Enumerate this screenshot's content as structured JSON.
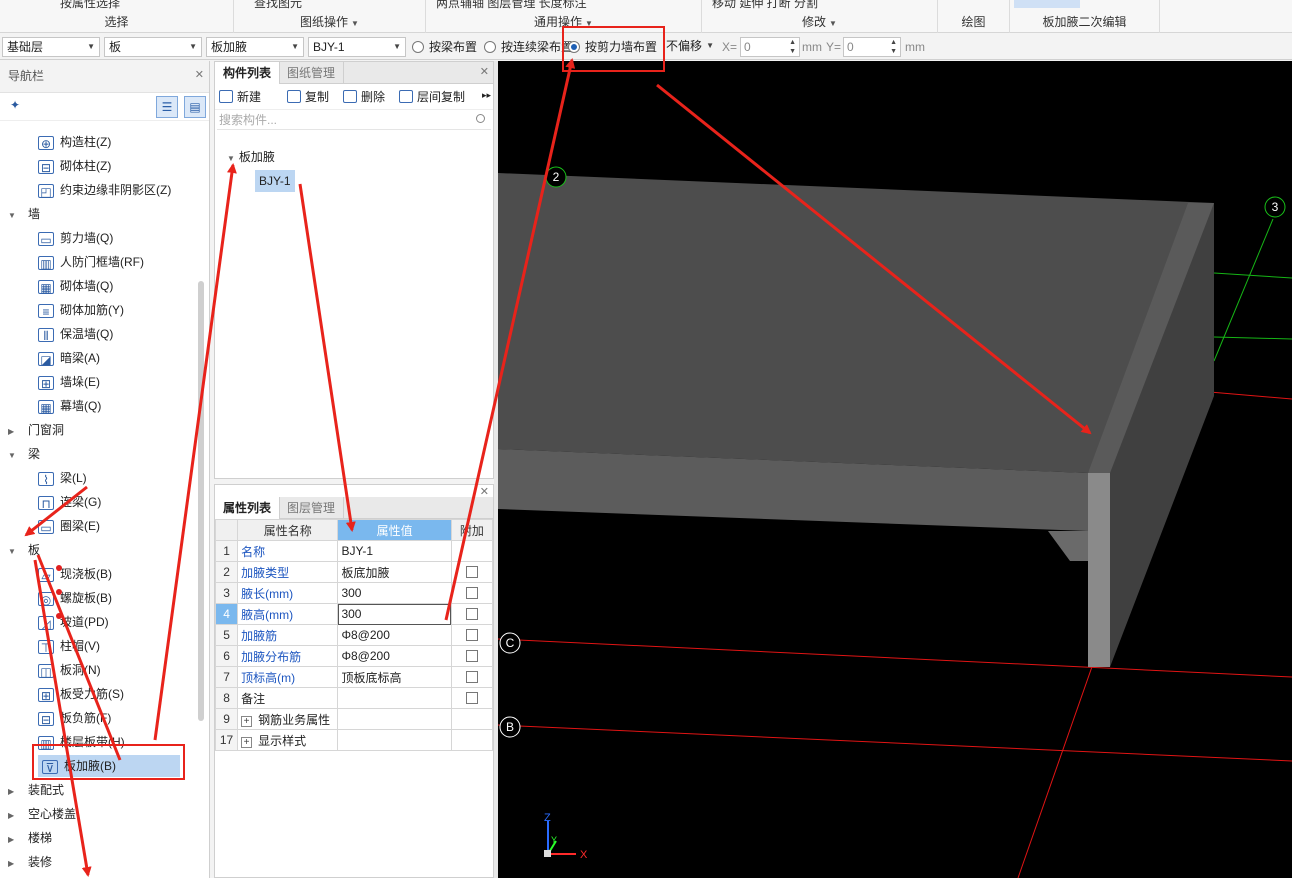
{
  "ribbon": {
    "groups": [
      {
        "label": "选择",
        "cut": "按属性选择"
      },
      {
        "label": "图纸操作",
        "cut": "查找图元"
      },
      {
        "label": "通用操作",
        "cut": "两点辅轴   图层管理   长度标注"
      },
      {
        "label": "修改",
        "cut": "移动   延伸   打断   分割"
      },
      {
        "label": "绘图",
        "cut": ""
      },
      {
        "label": "板加腋二次编辑",
        "cut": ""
      }
    ]
  },
  "toolbar": {
    "floor": "基础层",
    "category": "板",
    "type": "板加腋",
    "component": "BJY-1",
    "radio_beam": "按梁布置",
    "radio_continuous_beam": "按连续梁布置",
    "radio_shear_wall": "按剪力墙布置",
    "offset": "不偏移",
    "x_label": "X=",
    "x_value": "0",
    "y_label": "Y=",
    "y_value": "0",
    "unit": "mm"
  },
  "nav": {
    "title": "导航栏",
    "items": [
      {
        "label": "构造柱(Z)",
        "icon": "column-icon"
      },
      {
        "label": "砌体柱(Z)",
        "icon": "masonry-column-icon"
      },
      {
        "label": "约束边缘非阴影区(Z)",
        "icon": "edge-zone-icon"
      },
      {
        "label": "墙",
        "category": true
      },
      {
        "label": "剪力墙(Q)",
        "icon": "shear-wall-icon"
      },
      {
        "label": "人防门框墙(RF)",
        "icon": "door-frame-wall-icon"
      },
      {
        "label": "砌体墙(Q)",
        "icon": "masonry-wall-icon"
      },
      {
        "label": "砌体加筋(Y)",
        "icon": "masonry-rebar-icon"
      },
      {
        "label": "保温墙(Q)",
        "icon": "insulation-wall-icon"
      },
      {
        "label": "暗梁(A)",
        "icon": "hidden-beam-icon"
      },
      {
        "label": "墙垛(E)",
        "icon": "wall-pier-icon"
      },
      {
        "label": "幕墙(Q)",
        "icon": "curtain-wall-icon"
      },
      {
        "label": "门窗洞",
        "category": true
      },
      {
        "label": "梁",
        "category": true
      },
      {
        "label": "梁(L)",
        "icon": "beam-icon"
      },
      {
        "label": "连梁(G)",
        "icon": "coupling-beam-icon"
      },
      {
        "label": "圈梁(E)",
        "icon": "ring-beam-icon"
      },
      {
        "label": "板",
        "category": true
      },
      {
        "label": "现浇板(B)",
        "icon": "cast-slab-icon"
      },
      {
        "label": "螺旋板(B)",
        "icon": "spiral-slab-icon"
      },
      {
        "label": "坡道(PD)",
        "icon": "ramp-icon"
      },
      {
        "label": "柱帽(V)",
        "icon": "column-cap-icon"
      },
      {
        "label": "板洞(N)",
        "icon": "slab-hole-icon"
      },
      {
        "label": "板受力筋(S)",
        "icon": "slab-main-rebar-icon"
      },
      {
        "label": "板负筋(F)",
        "icon": "slab-neg-rebar-icon"
      },
      {
        "label": "楼层板带(H)",
        "icon": "slab-strip-icon"
      },
      {
        "label": "板加腋(B)",
        "icon": "slab-haunch-icon"
      },
      {
        "label": "装配式",
        "category": true
      },
      {
        "label": "空心楼盖",
        "category": true
      },
      {
        "label": "楼梯",
        "category": true
      },
      {
        "label": "装修",
        "category": true
      }
    ]
  },
  "components": {
    "tab_active": "构件列表",
    "tab_other": "图纸管理",
    "new_label": "新建",
    "copy_label": "复制",
    "delete_label": "删除",
    "floor_copy_label": "层间复制",
    "search_placeholder": "搜索构件...",
    "group": "板加腋",
    "item": "BJY-1"
  },
  "properties": {
    "tab_active": "属性列表",
    "tab_other": "图层管理",
    "col_name": "属性名称",
    "col_value": "属性值",
    "col_extra": "附加",
    "rows": [
      {
        "n": "1",
        "name": "名称",
        "value": "BJY-1",
        "check": false
      },
      {
        "n": "2",
        "name": "加腋类型",
        "value": "板底加腋",
        "check": true
      },
      {
        "n": "3",
        "name": "腋长(mm)",
        "value": "300",
        "check": true
      },
      {
        "n": "4",
        "name": "腋高(mm)",
        "value": "300",
        "check": true
      },
      {
        "n": "5",
        "name": "加腋筋",
        "value": "Φ8@200",
        "check": true
      },
      {
        "n": "6",
        "name": "加腋分布筋",
        "value": "Φ8@200",
        "check": true
      },
      {
        "n": "7",
        "name": "顶标高(m)",
        "value": "顶板底标高",
        "check": true
      },
      {
        "n": "8",
        "name": "备注",
        "value": "",
        "check": true
      },
      {
        "n": "9",
        "name": "钢筋业务属性",
        "value": "",
        "check": false,
        "expand": true
      },
      {
        "n": "17",
        "name": "显示样式",
        "value": "",
        "check": false,
        "expand": true
      }
    ]
  },
  "viewport": {
    "axis_labels": [
      "2",
      "3",
      "C",
      "B"
    ],
    "axis_x": "X",
    "axis_y": "Y",
    "axis_z": "Z"
  },
  "colors": {
    "annotation_red": "#e8231b",
    "selection_blue": "#7ab8ee",
    "link_blue": "#1d56c0"
  }
}
